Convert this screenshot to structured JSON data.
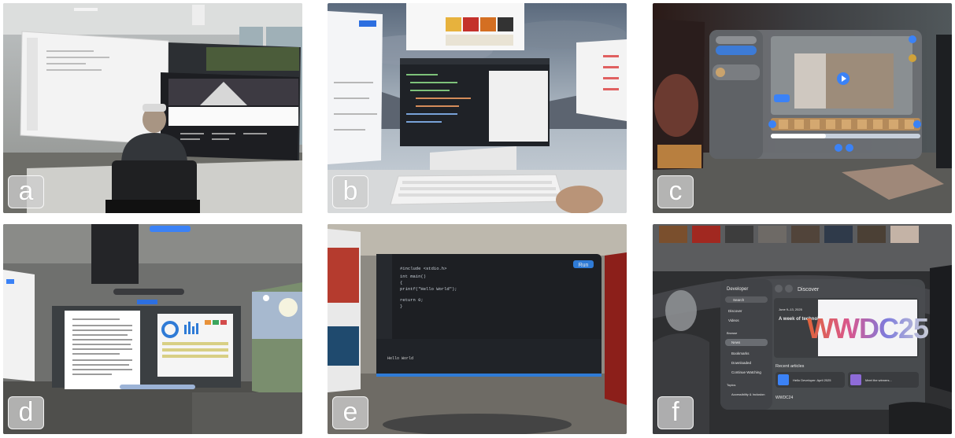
{
  "panels": [
    {
      "id": "a",
      "label": "a"
    },
    {
      "id": "b",
      "label": "b"
    },
    {
      "id": "c",
      "label": "c"
    },
    {
      "id": "d",
      "label": "d"
    },
    {
      "id": "e",
      "label": "e"
    },
    {
      "id": "f",
      "label": "f"
    }
  ],
  "panel_f": {
    "app_title": "Developer",
    "discover_title": "Discover",
    "sidebar_items": [
      "Search",
      "Discover",
      "Videos",
      "Browse",
      "News",
      "Bookmarks",
      "Downloaded",
      "Continue Watching",
      "Topics",
      "Accessibility & Inclusion"
    ],
    "hero_date": "June 9–13, 2025",
    "hero_heading": "A week of technology and creativity",
    "hero_logo": "WWDC25",
    "recent_articles": "Recent articles",
    "article_1": "Hello Developer: April 2025",
    "article_2": "Meet the winners...",
    "section_bottom": "WWDC24"
  },
  "panel_e": {
    "code_lines": [
      "#include <stdio.h>",
      "",
      "int main()",
      "{",
      "  printf(\"Hello World\");",
      "",
      "  return 0;",
      "}"
    ],
    "run_button": "Run",
    "console_text": "Hello World"
  }
}
